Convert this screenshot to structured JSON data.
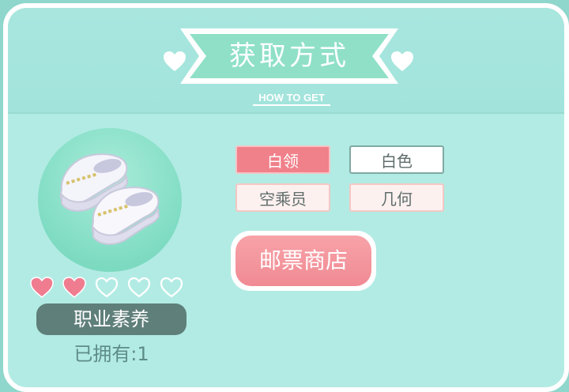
{
  "header": {
    "title": "获取方式",
    "subtitle": "HOW TO GET"
  },
  "item": {
    "icon": "white-loafers-icon",
    "hearts_filled": 2,
    "hearts_total": 5,
    "category": "职业素养",
    "owned": "已拥有:1"
  },
  "tags": [
    {
      "label": "白领",
      "style": "pink"
    },
    {
      "label": "白色",
      "style": "white"
    },
    {
      "label": "空乘员",
      "style": "light"
    },
    {
      "label": "几何",
      "style": "light"
    }
  ],
  "shop_button": {
    "label": "邮票商店"
  },
  "colors": {
    "panel": "#b2ebe4",
    "banner": "#8fe0c7",
    "pink_tag": "#f0808a",
    "shop_button": "#f08a93",
    "category_bg": "#5f7f7a"
  }
}
